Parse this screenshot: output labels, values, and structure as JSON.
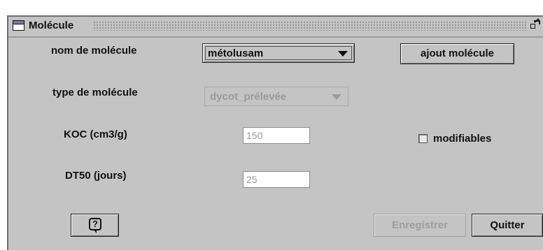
{
  "window": {
    "title": "Molécule"
  },
  "form": {
    "molecule_name": {
      "label": "nom de molécule",
      "selected": "métolusam"
    },
    "add_button": "ajout molécule",
    "molecule_type": {
      "label": "type de molécule",
      "selected": "dycot_prélevée"
    },
    "koc": {
      "label": "KOC (cm3/g)",
      "value": "150"
    },
    "modifiable": {
      "label": "modifiables",
      "checked": false
    },
    "dt50": {
      "label": "DT50 (jours)",
      "value": "25"
    }
  },
  "footer": {
    "help_symbol": "?",
    "save_label": "Enregistrer",
    "quit_label": "Quitter"
  },
  "icons": {
    "window_icon": "window-icon",
    "maximize": "maximize-icon",
    "help": "help-icon"
  }
}
